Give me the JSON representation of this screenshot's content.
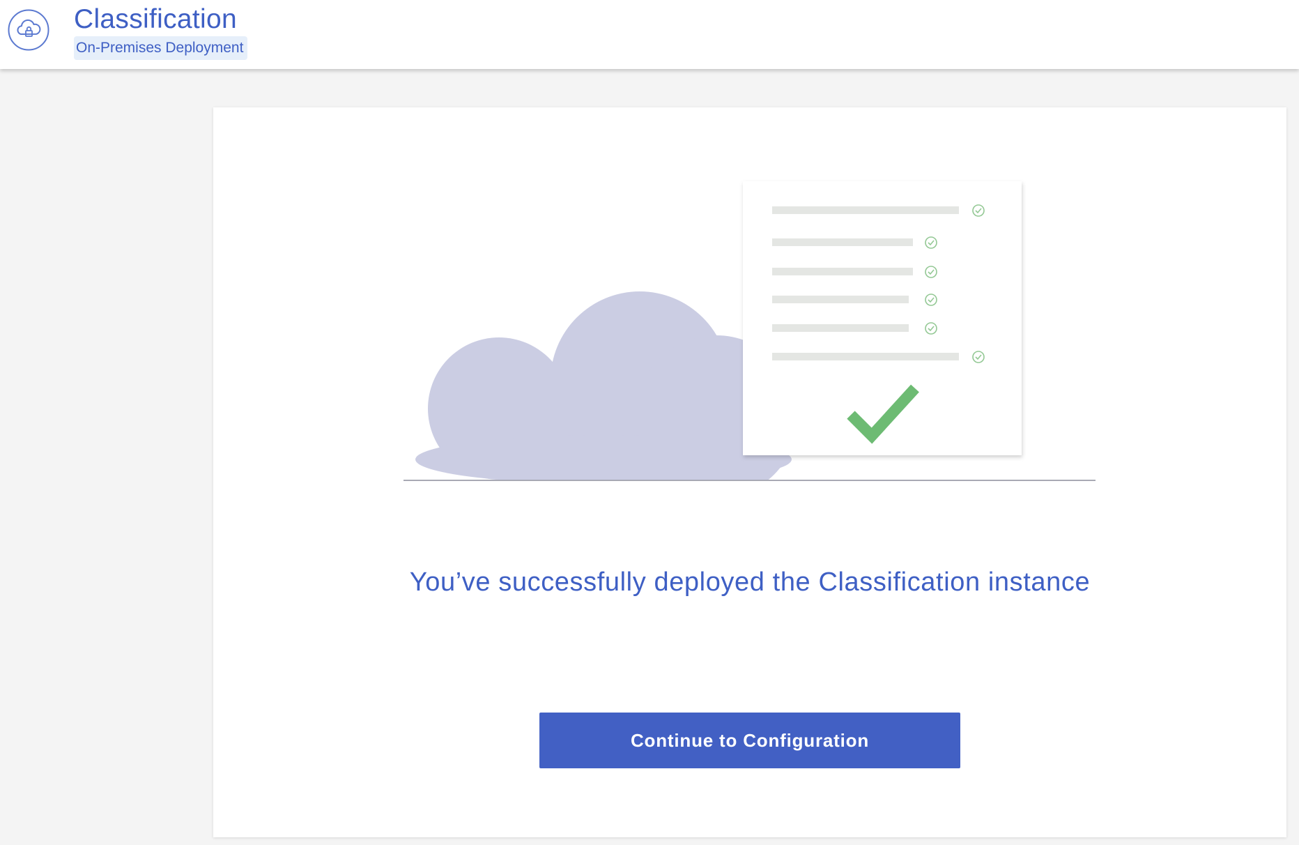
{
  "header": {
    "title": "Classification",
    "badge": "On-Premises Deployment",
    "icon": "cloud-lock-icon"
  },
  "main": {
    "illustration_icon": "cloud-document-checklist-illustration",
    "message": "You’ve successfully deployed the Classification instance",
    "continue_button_label": "Continue to Configuration"
  },
  "colors": {
    "brand": "#3e5fc4",
    "button": "#4260c4",
    "cloud": "#cbcde3",
    "check": "#6dbb73",
    "background": "#f4f4f4"
  }
}
